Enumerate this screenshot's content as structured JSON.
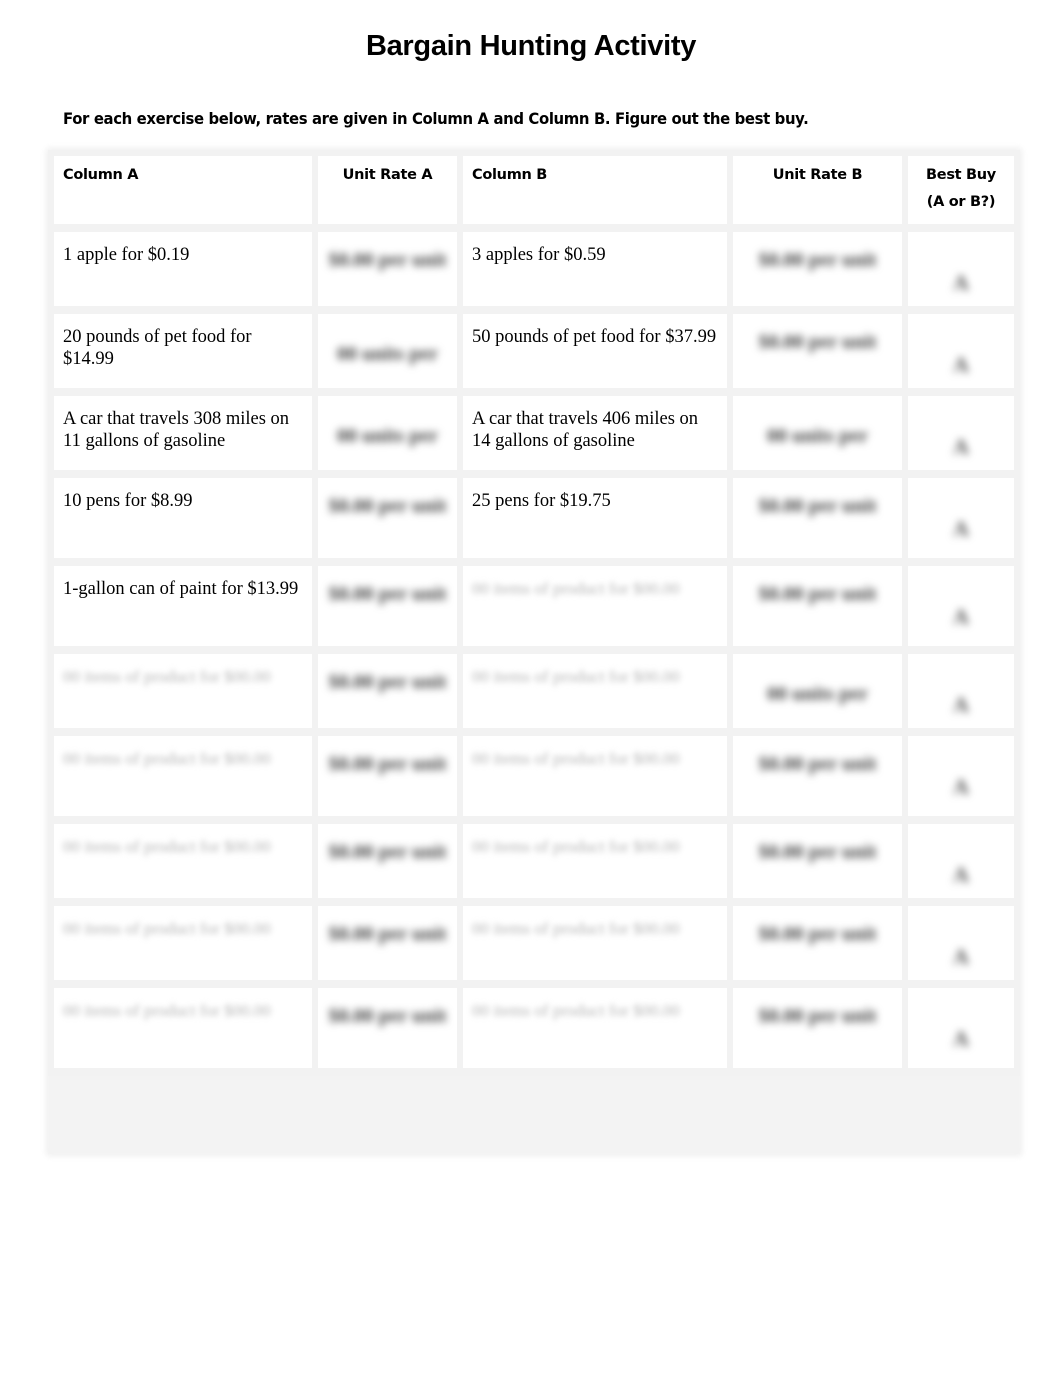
{
  "title": "Bargain Hunting Activity",
  "instructions": "For each exercise below, rates are given in Column A and Column B. Figure out the best buy.",
  "table": {
    "headers": {
      "column_a": "Column A",
      "unit_rate_a": "Unit Rate A",
      "column_b": "Column B",
      "unit_rate_b": "Unit Rate B",
      "best_buy_line1": "Best Buy",
      "best_buy_line2": "(A or B?)"
    },
    "rows": [
      {
        "column_a": "1 apple for $0.19",
        "unit_rate_a": "[blurred]",
        "column_b": "3 apples for $0.59",
        "unit_rate_b": "[blurred]",
        "best_buy": "[blurred]"
      },
      {
        "column_a": "20 pounds of pet food for $14.99",
        "unit_rate_a": "[blurred]",
        "column_b": "50 pounds of pet food for $37.99",
        "unit_rate_b": "[blurred]",
        "best_buy": "[blurred]"
      },
      {
        "column_a": "A car that travels 308 miles on 11 gallons of gasoline",
        "unit_rate_a": "[blurred]",
        "column_b": "A car that travels 406 miles on 14 gallons of gasoline",
        "unit_rate_b": "[blurred]",
        "best_buy": "[blurred]"
      },
      {
        "column_a": "10 pens for $8.99",
        "unit_rate_a": "[blurred]",
        "column_b": "25 pens for $19.75",
        "unit_rate_b": "[blurred]",
        "best_buy": "[blurred]"
      },
      {
        "column_a": "1-gallon can of paint for $13.99",
        "unit_rate_a": "[blurred]",
        "column_b": "[blurred]",
        "unit_rate_b": "[blurred]",
        "best_buy": "[blurred]"
      },
      {
        "column_a": "[blurred]",
        "unit_rate_a": "[blurred]",
        "column_b": "[blurred]",
        "unit_rate_b": "[blurred]",
        "best_buy": "[blurred]"
      },
      {
        "column_a": "[blurred]",
        "unit_rate_a": "[blurred]",
        "column_b": "[blurred]",
        "unit_rate_b": "[blurred]",
        "best_buy": "[blurred]"
      },
      {
        "column_a": "[blurred]",
        "unit_rate_a": "[blurred]",
        "column_b": "[blurred]",
        "unit_rate_b": "[blurred]",
        "best_buy": "[blurred]"
      },
      {
        "column_a": "[blurred]",
        "unit_rate_a": "[blurred]",
        "column_b": "[blurred]",
        "unit_rate_b": "[blurred]",
        "best_buy": "[blurred]"
      },
      {
        "column_a": "[blurred]",
        "unit_rate_a": "[blurred]",
        "column_b": "[blurred]",
        "unit_rate_b": "[blurred]",
        "best_buy": "[blurred]"
      }
    ]
  },
  "placeholders": {
    "rate_two_line": "$0.00 per unit",
    "rate_one_line": "00 units per",
    "desc_two_line": "00 items of product for $00.00",
    "letter": "A"
  }
}
